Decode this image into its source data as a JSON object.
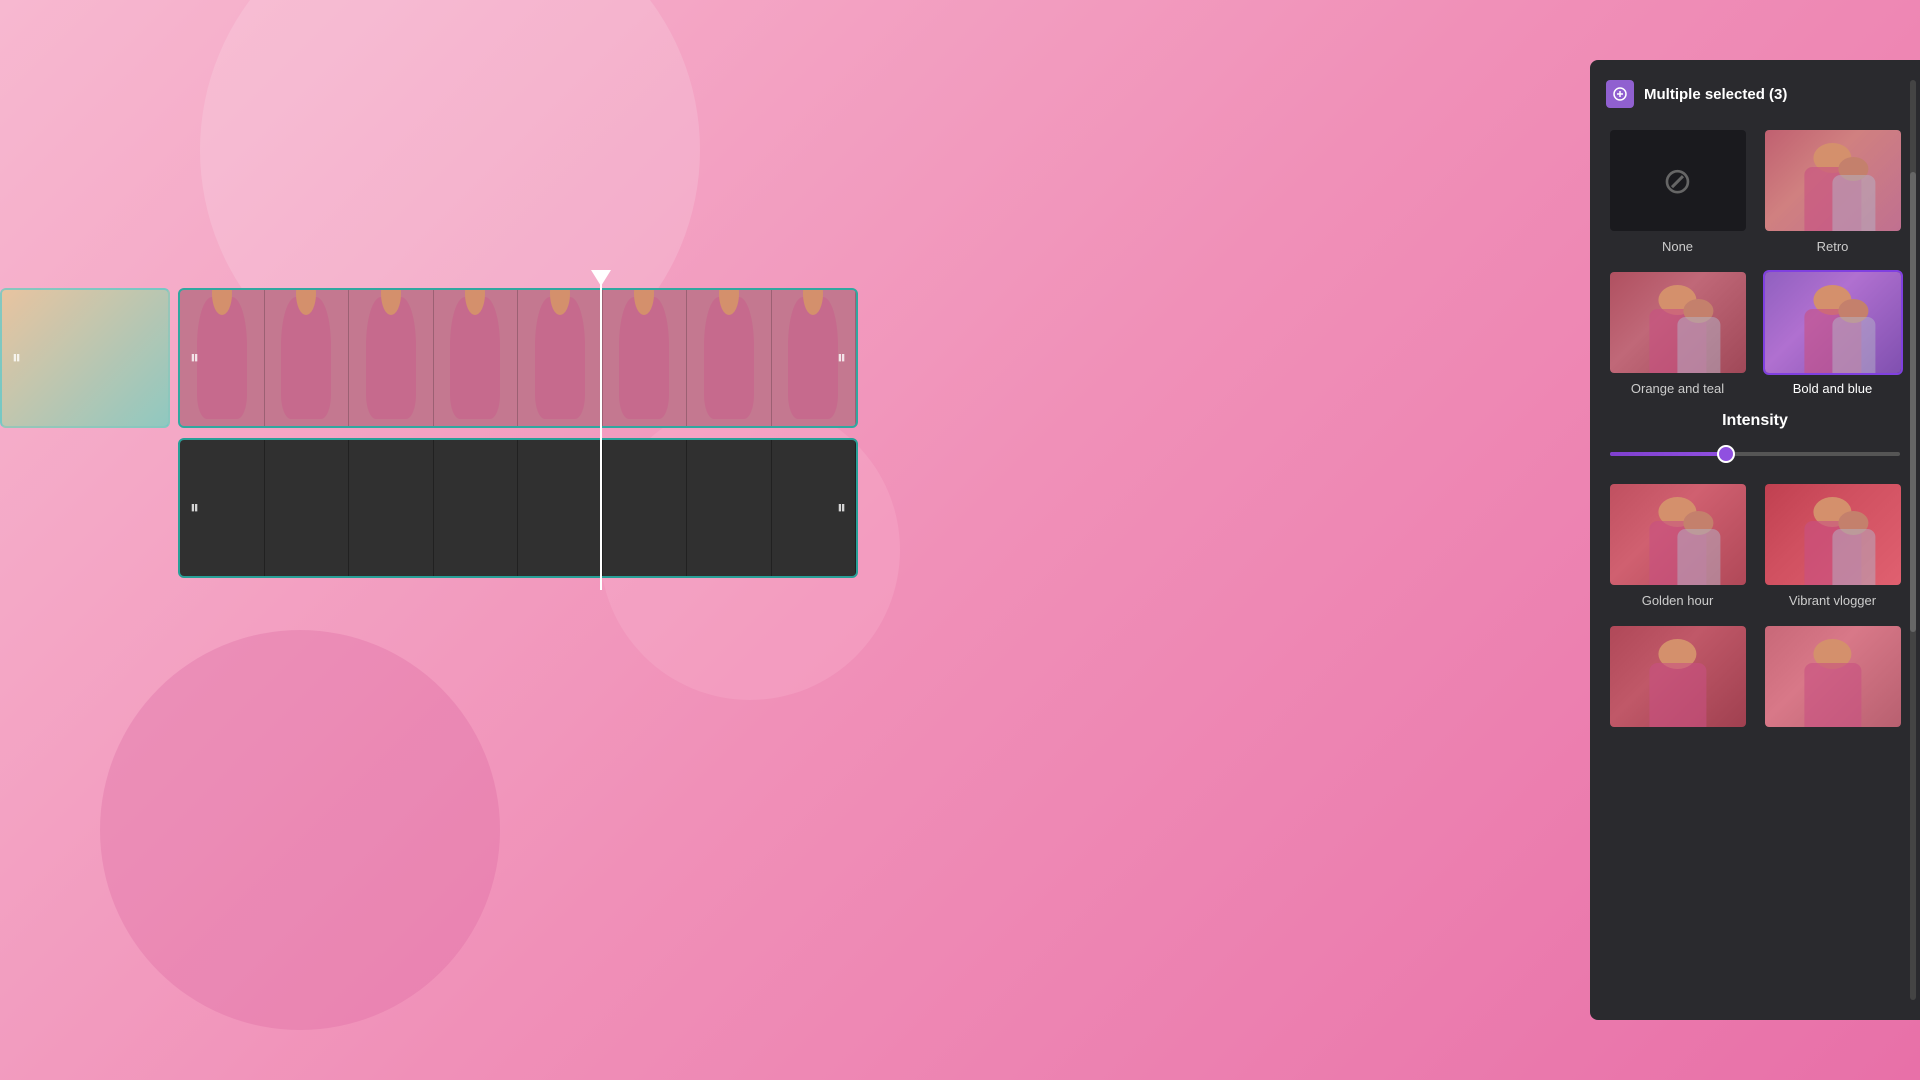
{
  "header": {
    "title": "Multiple selected (3)"
  },
  "filters": [
    {
      "id": "none",
      "label": "None",
      "selected": false
    },
    {
      "id": "retro",
      "label": "Retro",
      "selected": false
    },
    {
      "id": "orange_teal",
      "label": "Orange and teal",
      "selected": false
    },
    {
      "id": "bold_blue",
      "label": "Bold and blue",
      "selected": true
    },
    {
      "id": "golden_hour",
      "label": "Golden hour",
      "selected": false
    },
    {
      "id": "vibrant_vlogger",
      "label": "Vibrant vlogger",
      "selected": false
    }
  ],
  "intensity": {
    "label": "Intensity",
    "value": 40,
    "min": 0,
    "max": 100
  },
  "timeline": {
    "track1_pause_label": "⏸",
    "track2_pause_label": "⏸"
  },
  "colors": {
    "selected_border": "#8040e0",
    "accent": "#9050e0",
    "panel_bg": "#2a2a2e"
  }
}
